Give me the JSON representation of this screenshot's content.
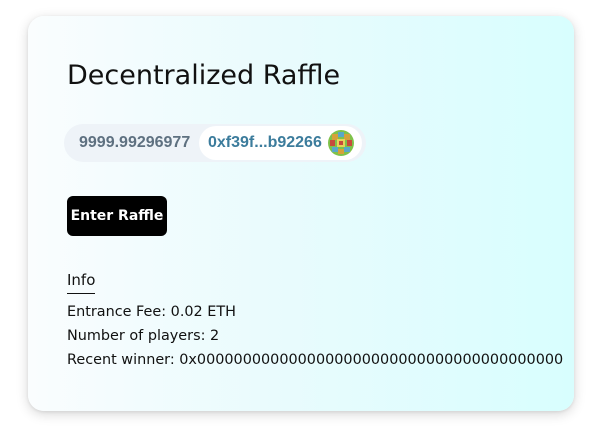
{
  "app": {
    "title": "Decentralized Raffle"
  },
  "wallet": {
    "balance": "9999.99296977",
    "address": "0xf39f...b92266",
    "avatar_icon": "identicon-avatar"
  },
  "actions": {
    "enter_label": "Enter Raffle"
  },
  "info": {
    "heading": "Info",
    "entrance_fee": "Entrance Fee: 0.02 ETH",
    "players": "Number of players: 2",
    "recent_winner": "Recent winner: 0x0000000000000000000000000000000000000000"
  },
  "colors": {
    "card_gradient_start": "#fafdfe",
    "card_gradient_end": "#d8fefe",
    "button_bg": "#000000",
    "address_text": "#3c7c9c",
    "balance_text": "#5e7080"
  }
}
